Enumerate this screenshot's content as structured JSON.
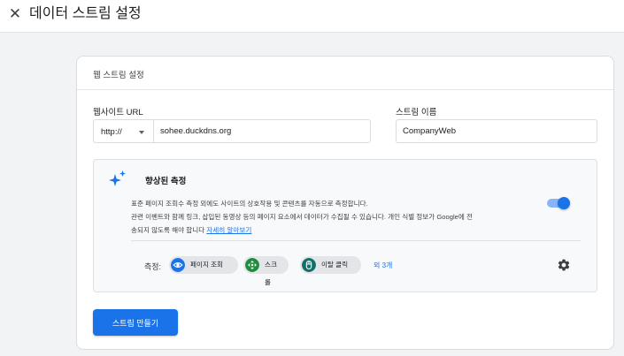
{
  "header": {
    "close_glyph": "✕",
    "title": "데이터 스트림 설정"
  },
  "card": {
    "title": "웹 스트림 설정"
  },
  "form": {
    "url_label": "웹사이트 URL",
    "protocol_value": "http://",
    "url_value": "sohee.duckdns.org",
    "name_label": "스트림 이름",
    "name_value": "CompanyWeb"
  },
  "enhanced_measurement": {
    "title": "향상된 측정",
    "desc_line1": "표준 페이지 조회수 측정 외에도 사이트의 상호작용 및 콘텐츠를 자동으로 측정합니다.",
    "desc_line2": "관련 이벤트와 함께 링크, 삽입된 동영상 등의 페이지 요소에서 데이터가 수집될 수 있습니다. 개인 식별 정보가 Google에 전",
    "desc_line3": "송되지 않도록 해야 합니다",
    "learn_more": "자세히 알아보기",
    "toggle_on": true,
    "measure_label": "측정:",
    "chips": [
      {
        "label": "페이지 조회",
        "icon": "eye-icon",
        "color": "#1a73e8"
      },
      {
        "label": "스크롤",
        "icon": "crosshair-icon",
        "color": "#1e8e3e"
      },
      {
        "label": "이탈 클릭",
        "icon": "mouse-icon",
        "color": "#12706b"
      }
    ],
    "more_label": "외 3개"
  },
  "actions": {
    "create_label": "스트림 만들기"
  },
  "colors": {
    "accent": "#1a73e8",
    "toggle_track": "#8ab4f8",
    "background": "#f1f3f4"
  }
}
